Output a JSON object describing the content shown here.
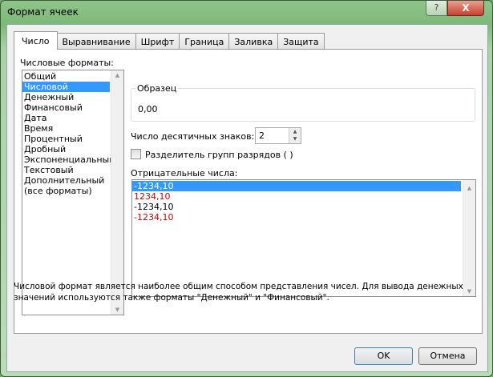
{
  "window": {
    "title": "Формат ячеек",
    "help": "?",
    "close": "X"
  },
  "tabs": [
    "Число",
    "Выравнивание",
    "Шрифт",
    "Граница",
    "Заливка",
    "Защита"
  ],
  "formats_label": "Числовые форматы:",
  "formats": [
    "Общий",
    "Числовой",
    "Денежный",
    "Финансовый",
    "Дата",
    "Время",
    "Процентный",
    "Дробный",
    "Экспоненциальный",
    "Текстовый",
    "Дополнительный",
    "(все форматы)"
  ],
  "selected_format": "Числовой",
  "sample": {
    "label": "Образец",
    "value": "0,00"
  },
  "decimals": {
    "label": "Число десятичных знаков:",
    "value": "2"
  },
  "separator": {
    "label": "Разделитель групп разрядов ( )",
    "checked": false
  },
  "negative": {
    "label": "Отрицательные числа:",
    "items": [
      {
        "text": "-1234,10",
        "color": "#000000"
      },
      {
        "text": "1234,10",
        "color": "#cc0000"
      },
      {
        "text": "-1234,10",
        "color": "#000000"
      },
      {
        "text": "-1234,10",
        "color": "#cc0000"
      }
    ]
  },
  "description": "Числовой формат является наиболее общим способом представления чисел. Для вывода денежных значений используются также форматы \"Денежный\" и \"Финансовый\".",
  "buttons": {
    "ok": "OK",
    "cancel": "Отмена"
  }
}
